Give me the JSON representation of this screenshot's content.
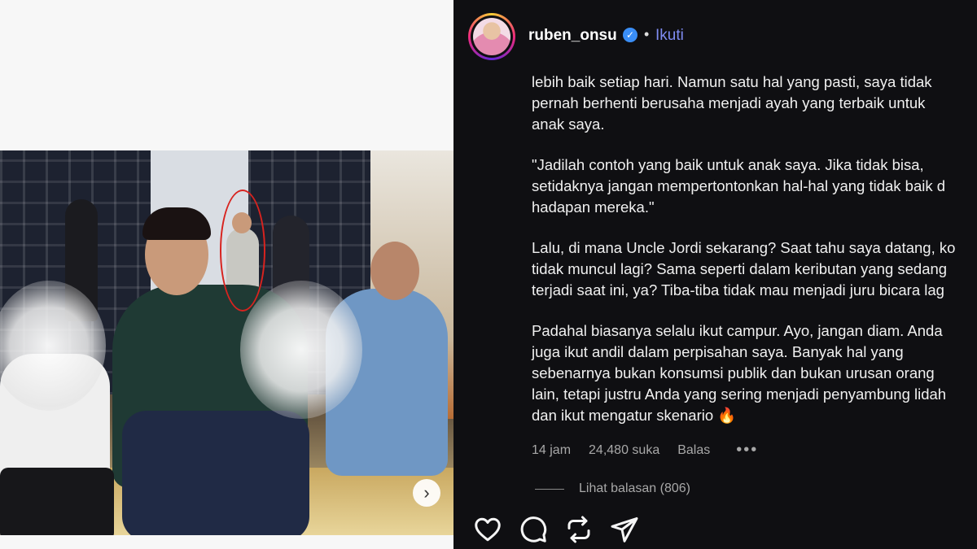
{
  "post": {
    "username": "ruben_onsu",
    "follow_label": "Ikuti",
    "separator": "•",
    "verified_icon": "verified-badge-icon",
    "colors": {
      "accent": "#7f8cf2",
      "verified": "#3a8ef6",
      "annotation_circle": "#d8231f"
    }
  },
  "comment": {
    "paragraphs": [
      [
        "lebih baik setiap hari. Namun satu hal yang pasti, saya tidak",
        "pernah berhenti berusaha menjadi ayah yang terbaik untuk",
        "anak saya."
      ],
      [
        "\"Jadilah contoh yang baik untuk anak saya. Jika tidak bisa,",
        "setidaknya jangan mempertontonkan hal-hal yang tidak baik d",
        "hadapan mereka.\""
      ],
      [
        "Lalu, di mana Uncle Jordi sekarang? Saat tahu saya datang, ko",
        "tidak muncul lagi? Sama seperti dalam keributan yang sedang",
        "terjadi saat ini, ya? Tiba-tiba tidak mau menjadi juru bicara lag"
      ],
      [
        "Padahal biasanya selalu ikut campur. Ayo, jangan diam. Anda",
        "juga ikut andil dalam perpisahan saya. Banyak hal yang",
        "sebenarnya bukan konsumsi publik dan bukan urusan orang",
        "lain, tetapi justru Anda yang sering menjadi penyambung lidah",
        "dan ikut mengatur skenario 🔥"
      ]
    ]
  },
  "meta": {
    "time": "14 jam",
    "likes": "24,480 suka",
    "reply_label": "Balas",
    "more": "•••"
  },
  "replies": {
    "label": "Lihat balasan (806)"
  },
  "actions": [
    "heart-icon",
    "comment-icon",
    "repost-icon",
    "share-icon"
  ],
  "photo": {
    "next_arrow": "›"
  }
}
